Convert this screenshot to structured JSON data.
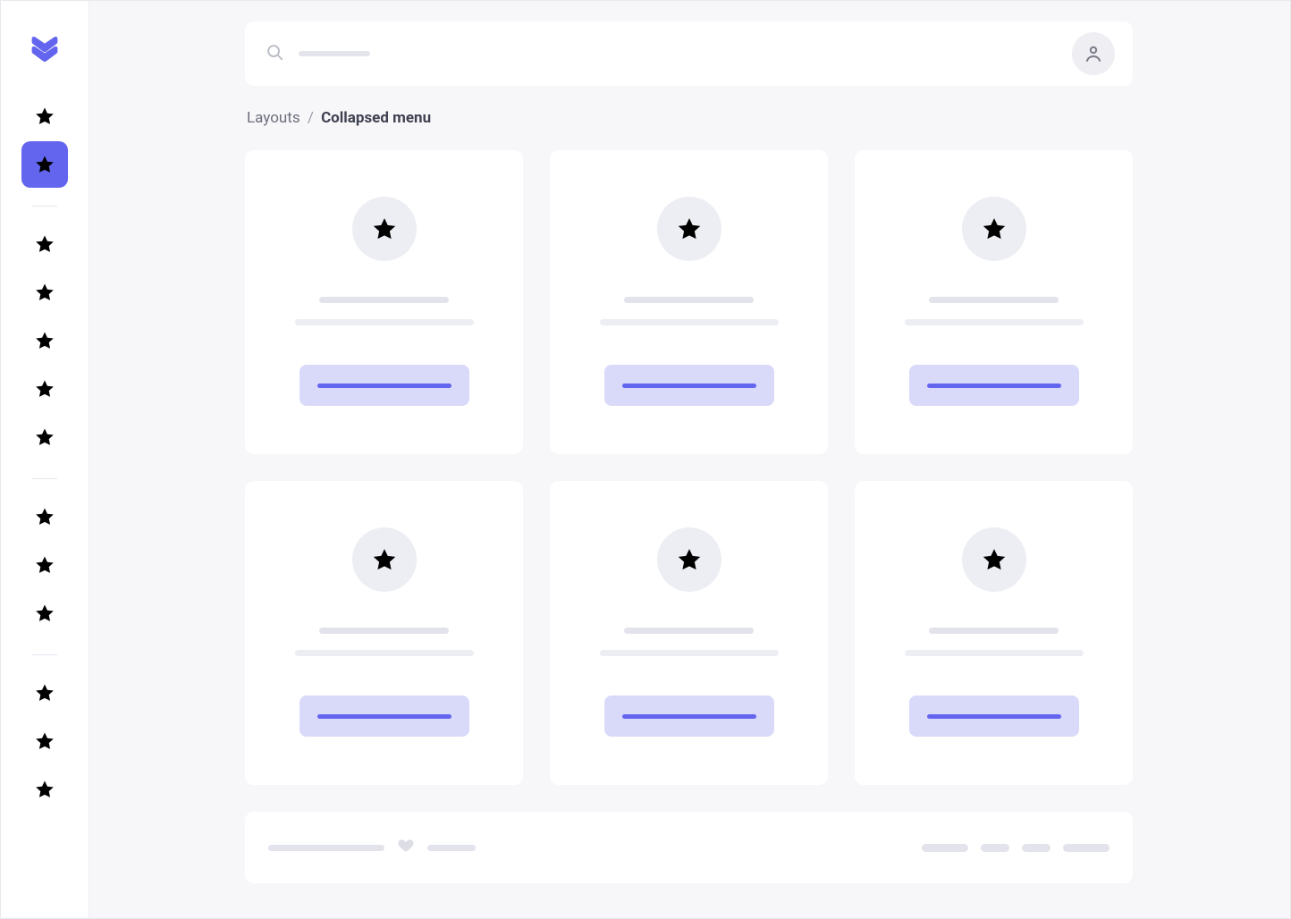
{
  "breadcrumb": {
    "parent": "Layouts",
    "separator": "/",
    "current": "Collapsed menu"
  },
  "sidebar": {
    "logo": "logo",
    "groups": [
      {
        "items": [
          {
            "icon": "star",
            "active": false
          },
          {
            "icon": "star",
            "active": true
          }
        ]
      },
      {
        "items": [
          {
            "icon": "star",
            "active": false
          },
          {
            "icon": "star",
            "active": false
          },
          {
            "icon": "star",
            "active": false
          },
          {
            "icon": "star",
            "active": false
          },
          {
            "icon": "star",
            "active": false
          }
        ]
      },
      {
        "items": [
          {
            "icon": "star",
            "active": false
          },
          {
            "icon": "star",
            "active": false
          },
          {
            "icon": "star",
            "active": false
          }
        ]
      },
      {
        "items": [
          {
            "icon": "star",
            "active": false
          },
          {
            "icon": "star",
            "active": false
          },
          {
            "icon": "star",
            "active": false
          }
        ]
      }
    ]
  },
  "header": {
    "search_placeholder": "",
    "avatar_icon": "user"
  },
  "cards": [
    {
      "icon": "star"
    },
    {
      "icon": "star"
    },
    {
      "icon": "star"
    },
    {
      "icon": "star"
    },
    {
      "icon": "star"
    },
    {
      "icon": "star"
    }
  ],
  "colors": {
    "accent": "#6365ef",
    "accent_light": "#d9d9f9",
    "bg": "#f7f7fa",
    "surface": "#ffffff",
    "placeholder": "#e3e4eb"
  }
}
